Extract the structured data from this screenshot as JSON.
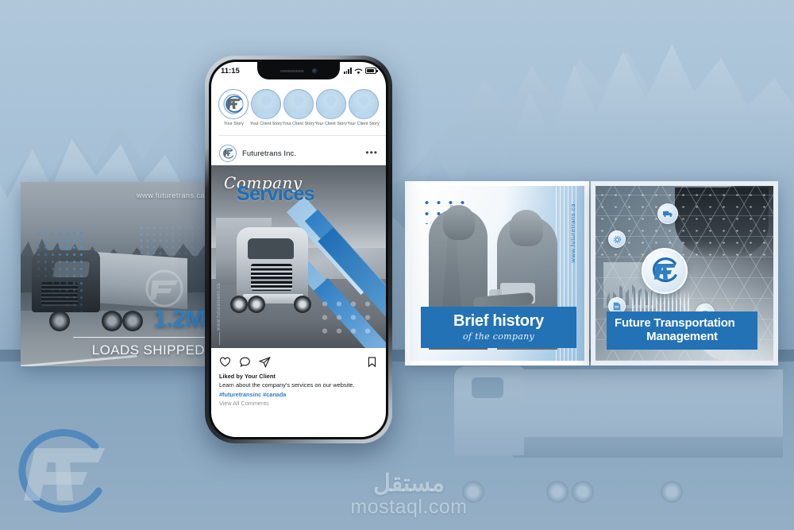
{
  "background": {
    "scene": "blue-tinted mountain landscape with highway truck",
    "watermark_logo": "FT",
    "credit": {
      "arabic": "مستقل",
      "domain": "mostaql.com"
    }
  },
  "brand": {
    "name": "Futuretrans Inc.",
    "mark": "FT",
    "accent": "#2272b5",
    "accent_light": "#4e93d1",
    "website": "www.futuretrans.ca"
  },
  "phone": {
    "status_bar": {
      "time": "11:15",
      "signal": "signal-icon",
      "wifi": "wifi-icon",
      "battery": "battery-icon"
    },
    "stories": [
      {
        "label": "Your Story",
        "type": "own"
      },
      {
        "label": "Your Client Story",
        "type": "client"
      },
      {
        "label": "Your Client Story",
        "type": "client"
      },
      {
        "label": "Your Client Story",
        "type": "client"
      },
      {
        "label": "Your Client Story",
        "type": "client"
      }
    ],
    "post": {
      "account": "Futuretrans Inc.",
      "more_label": "•••",
      "image": {
        "script_title": "Company",
        "bold_title": "Services",
        "vertical_url": "www.futuretrans.ca"
      },
      "actions": {
        "like": "heart-icon",
        "comment": "comment-icon",
        "share": "share-icon",
        "save": "bookmark-icon"
      },
      "liked_by": "Liked by Your Client",
      "caption": "Learn about the company's services on our website.",
      "hashtags": "#futuretransinc #canada",
      "view_comments": "View All Comments"
    }
  },
  "cards": {
    "loads": {
      "url": "www.futuretrans.ca",
      "stat": "1.2M",
      "label": "LOADS SHIPPED"
    },
    "history": {
      "title": "Brief history",
      "subtitle": "of the company",
      "vertical_url": "www.futuretrans.ca"
    },
    "future": {
      "title_line1": "Future Transportation",
      "title_line2": "Management",
      "badges": [
        "truck-badge-icon",
        "gear-badge-icon",
        "document-badge-icon",
        "shipping-badge-icon"
      ]
    }
  }
}
